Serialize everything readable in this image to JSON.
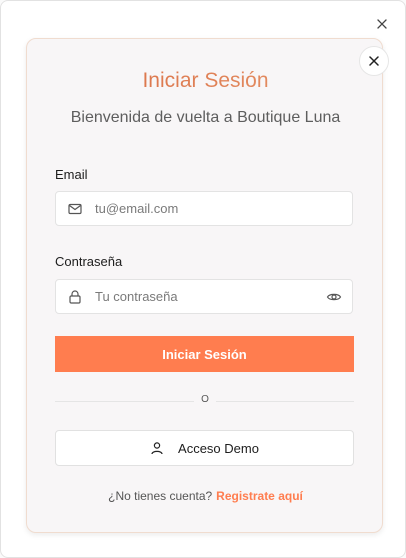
{
  "modal": {
    "title": "Iniciar Sesión",
    "subtitle": "Bienvenida de vuelta a Boutique Luna"
  },
  "email": {
    "label": "Email",
    "placeholder": "tu@email.com",
    "value": ""
  },
  "password": {
    "label": "Contraseña",
    "placeholder": "Tu contraseña",
    "value": ""
  },
  "buttons": {
    "login": "Iniciar Sesión",
    "demo": "Acceso Demo"
  },
  "divider": "O",
  "footer": {
    "prompt": "¿No tienes cuenta?",
    "link": "Registrate aquí"
  },
  "icons": {
    "outer_close": "close-icon",
    "inner_close": "close-icon",
    "email": "mail-icon",
    "password": "lock-icon",
    "toggle": "eye-icon",
    "demo": "user-icon"
  },
  "colors": {
    "accent": "#ff7d4f",
    "title_gradient_start": "#d8683e",
    "title_gradient_end": "#e79a6f"
  }
}
